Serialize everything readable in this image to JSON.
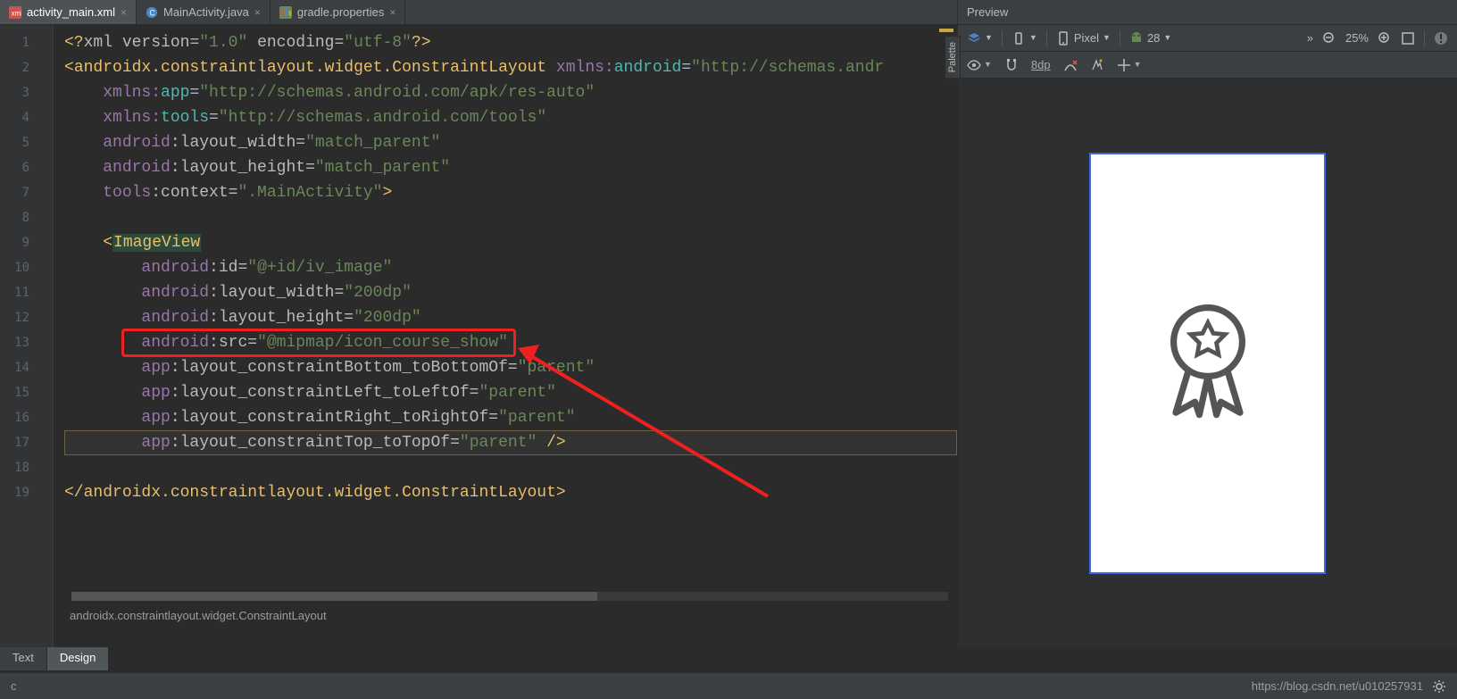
{
  "tabs": [
    {
      "label": "activity_main.xml",
      "active": true
    },
    {
      "label": "MainActivity.java",
      "active": false
    },
    {
      "label": "gradle.properties",
      "active": false
    }
  ],
  "lines": [
    "1",
    "2",
    "3",
    "4",
    "5",
    "6",
    "7",
    "8",
    "9",
    "10",
    "11",
    "12",
    "13",
    "14",
    "15",
    "16",
    "17",
    "18",
    "19"
  ],
  "code": {
    "l1_a": "<?",
    "l1_b": "xml version",
    "l1_c": "=",
    "l1_d": "\"1.0\"",
    "l1_e": " encoding",
    "l1_f": "=",
    "l1_g": "\"utf-8\"",
    "l1_h": "?>",
    "l2_a": "<",
    "l2_b": "androidx.constraintlayout.widget.ConstraintLayout",
    "l2_c": " ",
    "l2_d": "xmlns:",
    "l2_e": "android",
    "l2_f": "=",
    "l2_g": "\"http://schemas.andr",
    "l3_a": "    ",
    "l3_b": "xmlns:",
    "l3_c": "app",
    "l3_d": "=",
    "l3_e": "\"http://schemas.android.com/apk/res-auto\"",
    "l4_a": "    ",
    "l4_b": "xmlns:",
    "l4_c": "tools",
    "l4_d": "=",
    "l4_e": "\"http://schemas.android.com/tools\"",
    "l5_a": "    ",
    "l5_b": "android",
    "l5_c": ":layout_width=",
    "l5_d": "\"match_parent\"",
    "l6_a": "    ",
    "l6_b": "android",
    "l6_c": ":layout_height=",
    "l6_d": "\"match_parent\"",
    "l7_a": "    ",
    "l7_b": "tools",
    "l7_c": ":context=",
    "l7_d": "\".MainActivity\"",
    "l7_e": ">",
    "l9_a": "    <",
    "l9_b": "ImageView",
    "l10_a": "        ",
    "l10_b": "android",
    "l10_c": ":id=",
    "l10_d": "\"@+id/iv_image\"",
    "l11_a": "        ",
    "l11_b": "android",
    "l11_c": ":layout_width=",
    "l11_d": "\"200dp\"",
    "l12_a": "        ",
    "l12_b": "android",
    "l12_c": ":layout_height=",
    "l12_d": "\"200dp\"",
    "l13_a": "        ",
    "l13_b": "android",
    "l13_c": ":src=",
    "l13_d": "\"@mipmap/icon_course_show\"",
    "l14_a": "        ",
    "l14_b": "app",
    "l14_c": ":layout_constraintBottom_toBottomOf=",
    "l14_d": "\"parent\"",
    "l15_a": "        ",
    "l15_b": "app",
    "l15_c": ":layout_constraintLeft_toLeftOf=",
    "l15_d": "\"parent\"",
    "l16_a": "        ",
    "l16_b": "app",
    "l16_c": ":layout_constraintRight_toRightOf=",
    "l16_d": "\"parent\"",
    "l17_a": "        ",
    "l17_b": "app",
    "l17_c": ":layout_constraintTop_toTopOf=",
    "l17_d": "\"parent\"",
    "l17_e": " />",
    "l19_a": "</",
    "l19_b": "androidx.constraintlayout.widget.ConstraintLayout",
    "l19_c": ">"
  },
  "breadcrumb": "androidx.constraintlayout.widget.ConstraintLayout",
  "bottom_tabs": {
    "text": "Text",
    "design": "Design"
  },
  "preview": {
    "title": "Preview",
    "device": "Pixel",
    "api": "28",
    "zoom": "25%",
    "unit": "8dp"
  },
  "palette_label": "Palette",
  "status": {
    "left": "c",
    "url": "https://blog.csdn.net/u010257931"
  }
}
